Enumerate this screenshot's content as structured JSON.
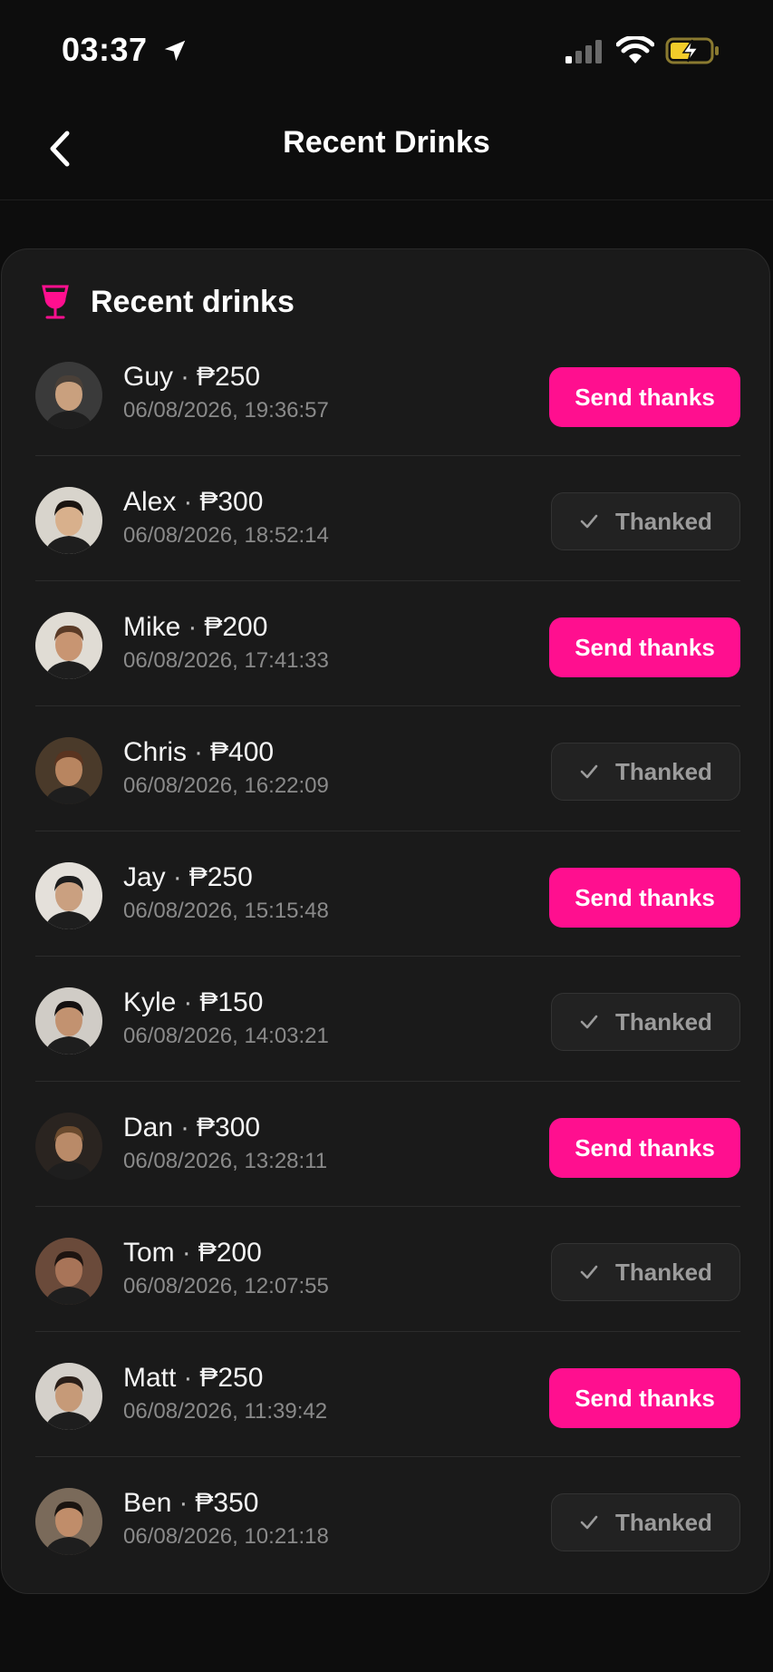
{
  "status_bar": {
    "time": "03:37",
    "icons": [
      "location-arrow-icon",
      "signal-icon",
      "wifi-icon",
      "battery-charging-icon"
    ]
  },
  "header": {
    "back_icon": "chevron-left-icon",
    "title": "Recent Drinks"
  },
  "card": {
    "icon": "wine-glass-icon",
    "title": "Recent drinks"
  },
  "buttons": {
    "send_label": "Send thanks",
    "thanked_label": "Thanked"
  },
  "colors": {
    "accent": "#ff0f8f",
    "background": "#0d0d0d",
    "card": "#1a1a1a"
  },
  "drinks": [
    {
      "name": "Guy",
      "amount": "₱250",
      "timestamp": "06/08/2026, 19:36:57",
      "status": "send"
    },
    {
      "name": "Alex",
      "amount": "₱300",
      "timestamp": "06/08/2026, 18:52:14",
      "status": "thanked"
    },
    {
      "name": "Mike",
      "amount": "₱200",
      "timestamp": "06/08/2026, 17:41:33",
      "status": "send"
    },
    {
      "name": "Chris",
      "amount": "₱400",
      "timestamp": "06/08/2026, 16:22:09",
      "status": "thanked"
    },
    {
      "name": "Jay",
      "amount": "₱250",
      "timestamp": "06/08/2026, 15:15:48",
      "status": "send"
    },
    {
      "name": "Kyle",
      "amount": "₱150",
      "timestamp": "06/08/2026, 14:03:21",
      "status": "thanked"
    },
    {
      "name": "Dan",
      "amount": "₱300",
      "timestamp": "06/08/2026, 13:28:11",
      "status": "send"
    },
    {
      "name": "Tom",
      "amount": "₱200",
      "timestamp": "06/08/2026, 12:07:55",
      "status": "thanked"
    },
    {
      "name": "Matt",
      "amount": "₱250",
      "timestamp": "06/08/2026, 11:39:42",
      "status": "send"
    },
    {
      "name": "Ben",
      "amount": "₱350",
      "timestamp": "06/08/2026, 10:21:18",
      "status": "thanked"
    }
  ]
}
